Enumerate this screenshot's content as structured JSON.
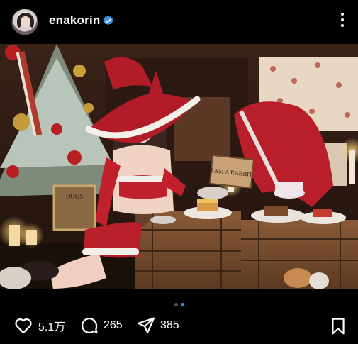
{
  "post": {
    "username": "enakorin",
    "verified": true
  },
  "photo": {
    "sign_text": "I AM A RABBIT",
    "frame_text": "DOGS"
  },
  "carousel": {
    "total": 2,
    "active": 2
  },
  "actions": {
    "likes": "5.1万",
    "comments": "265",
    "shares": "385"
  },
  "colors": {
    "background": "#000000",
    "verified_badge": "#3897f0",
    "carousel_active": "#2f8cff",
    "outfit_red": "#c0202c"
  },
  "icons": [
    "heart-icon",
    "comment-icon",
    "share-icon",
    "bookmark-icon",
    "more-icon",
    "verified-icon"
  ]
}
